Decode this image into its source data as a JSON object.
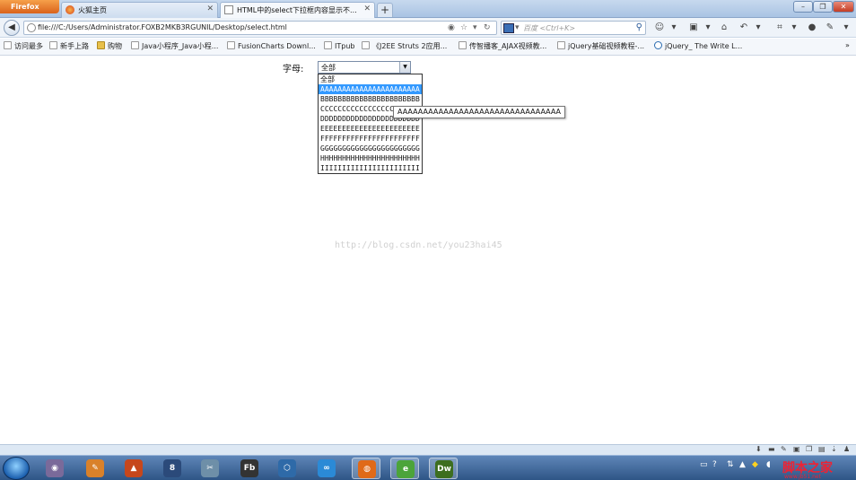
{
  "browser": {
    "app_button": "Firefox",
    "tabs": [
      {
        "label": "火狐主页",
        "active": false
      },
      {
        "label": "HTML中的select下拉框内容显示不...",
        "active": true
      }
    ],
    "new_tab": "+",
    "url": "file:///C:/Users/Administrator.FOXB2MKB3RGUNIL/Desktop/select.html",
    "search_placeholder": "百度 <Ctrl+K>",
    "window_buttons": [
      "–",
      "❐",
      "✕"
    ]
  },
  "bookmarks": [
    {
      "label": "访问最多",
      "icon": "bookmark-icon"
    },
    {
      "label": "新手上路",
      "icon": "page-icon"
    },
    {
      "label": "购物",
      "icon": "folder-icon"
    },
    {
      "label": "Java小程序_Java小程...",
      "icon": "page-icon"
    },
    {
      "label": "FusionCharts Downl...",
      "icon": "page-icon"
    },
    {
      "label": "ITpub",
      "icon": "page-icon"
    },
    {
      "label": "《J2EE Struts 2应用...",
      "icon": "page-icon"
    },
    {
      "label": "传智播客_AJAX视频教...",
      "icon": "page-icon"
    },
    {
      "label": "jQuery基础视频教程-...",
      "icon": "page-icon"
    },
    {
      "label": "jQuery_ The Write L...",
      "icon": "jquery-icon"
    }
  ],
  "page": {
    "field_label": "字母:",
    "select_value": "全部",
    "options": [
      "全部",
      "AAAAAAAAAAAAAAAAAAAAAAA",
      "BBBBBBBBBBBBBBBBBBBBBBB",
      "CCCCCCCCCCCCCCCCCCCCCCC",
      "DDDDDDDDDDDDDDDDDDDDDDD",
      "EEEEEEEEEEEEEEEEEEEEEEE",
      "FFFFFFFFFFFFFFFFFFFFFFF",
      "GGGGGGGGGGGGGGGGGGGGGGG",
      "HHHHHHHHHHHHHHHHHHHHHHH",
      "IIIIIIIIIIIIIIIIIIIIIII"
    ],
    "highlighted_option_index": 1,
    "tooltip": "AAAAAAAAAAAAAAAAAAAAAAAAAAAAAAAA",
    "watermark": "http://blog.csdn.net/you23hai45"
  },
  "taskbar": {
    "apps": [
      {
        "name": "opera",
        "color": "#7a6a9a",
        "glyph": "◉"
      },
      {
        "name": "paint",
        "color": "#d9812a",
        "glyph": "✎"
      },
      {
        "name": "matlab",
        "color": "#c6471c",
        "glyph": "▲"
      },
      {
        "name": "eclipse",
        "color": "#2b4a7a",
        "glyph": "8"
      },
      {
        "name": "tool",
        "color": "#6e8fa8",
        "glyph": "✂"
      },
      {
        "name": "flash-builder",
        "color": "#333",
        "glyph": "Fb"
      },
      {
        "name": "virtualbox",
        "color": "#2e6aa8",
        "glyph": "⬡"
      },
      {
        "name": "messenger",
        "color": "#2b8ad6",
        "glyph": "∞"
      },
      {
        "name": "firefox",
        "color": "#e06a18",
        "glyph": "◍"
      },
      {
        "name": "browser2",
        "color": "#4ca43a",
        "glyph": "e"
      },
      {
        "name": "dreamweaver",
        "color": "#3d6e1f",
        "glyph": "Dw"
      }
    ],
    "watermark_site": "脚本之家",
    "watermark_url": "www.jb51.net"
  }
}
